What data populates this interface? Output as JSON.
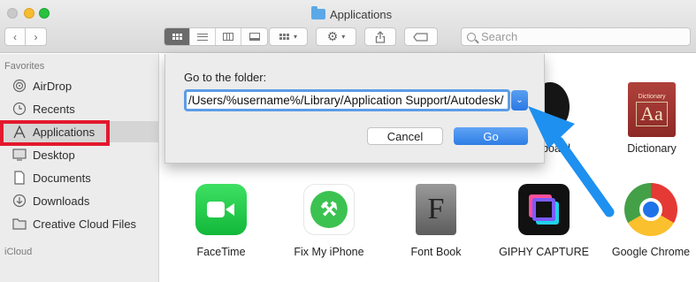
{
  "window": {
    "title": "Applications"
  },
  "toolbar": {
    "back_icon": "chevron-left-icon",
    "forward_icon": "chevron-right-icon",
    "search_placeholder": "Search"
  },
  "sidebar": {
    "favorites_heading": "Favorites",
    "items": [
      {
        "label": "AirDrop",
        "icon": "airdrop-icon"
      },
      {
        "label": "Recents",
        "icon": "clock-icon"
      },
      {
        "label": "Applications",
        "icon": "applications-icon",
        "selected": true
      },
      {
        "label": "Desktop",
        "icon": "desktop-icon"
      },
      {
        "label": "Documents",
        "icon": "documents-icon"
      },
      {
        "label": "Downloads",
        "icon": "downloads-icon"
      },
      {
        "label": "Creative Cloud Files",
        "icon": "folder-icon"
      }
    ],
    "icloud_heading": "iCloud"
  },
  "apps": {
    "partial_label": "board",
    "dictionary": "Dictionary",
    "facetime": "FaceTime",
    "fix_my_iphone": "Fix My iPhone",
    "font_book": "Font Book",
    "giphy_capture": "GIPHY CAPTURE",
    "google_chrome": "Google Chrome"
  },
  "dialog": {
    "label": "Go to the folder:",
    "path_value": "/Users/%username%/Library/Application Support/Autodesk/",
    "cancel_label": "Cancel",
    "go_label": "Go"
  },
  "colors": {
    "annotation_red": "#e3192d",
    "annotation_arrow": "#1e90f0",
    "accent_blue": "#2e7de5"
  }
}
